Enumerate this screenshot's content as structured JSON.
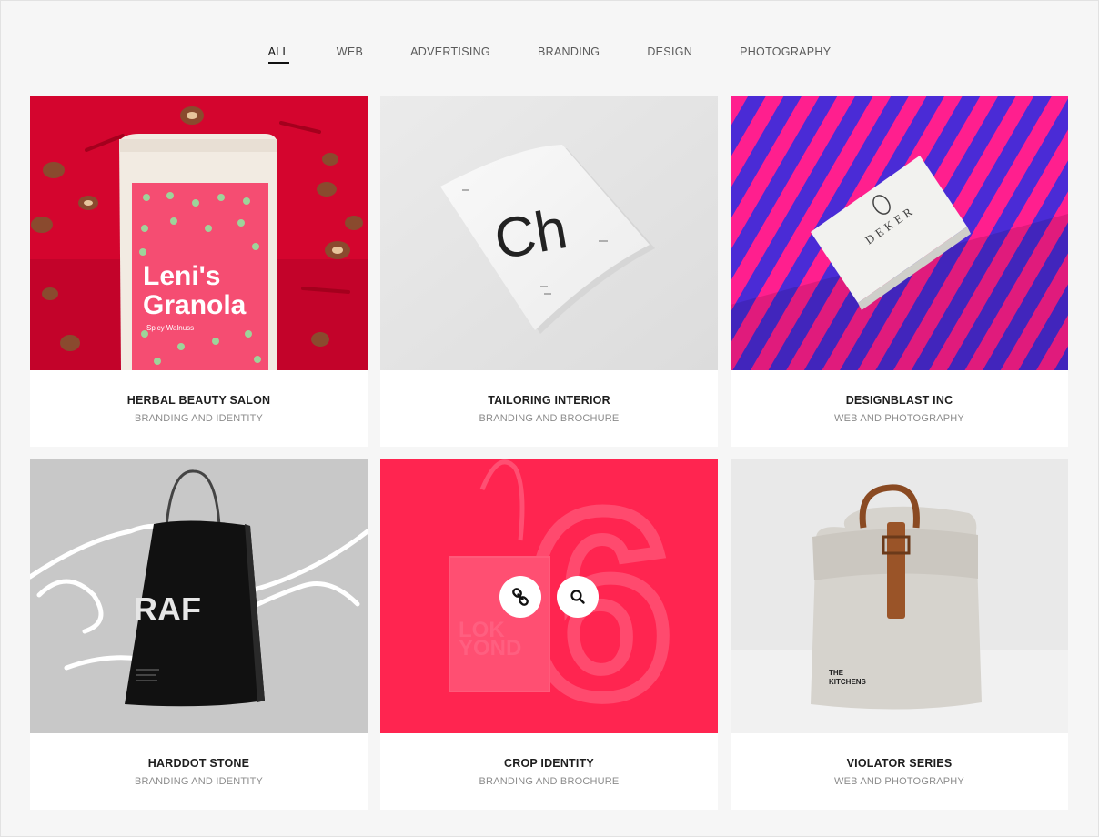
{
  "filters": [
    {
      "label": "ALL",
      "active": true
    },
    {
      "label": "WEB",
      "active": false
    },
    {
      "label": "ADVERTISING",
      "active": false
    },
    {
      "label": "BRANDING",
      "active": false
    },
    {
      "label": "DESIGN",
      "active": false
    },
    {
      "label": "PHOTOGRAPHY",
      "active": false
    }
  ],
  "portfolio": [
    {
      "title": "HERBAL BEAUTY SALON",
      "category": "BRANDING AND IDENTITY",
      "image_text_1": "Leni's",
      "image_text_2": "Granola",
      "image_text_3": "Spicy Walnuss"
    },
    {
      "title": "TAILORING INTERIOR",
      "category": "BRANDING AND BROCHURE",
      "image_text_1": "Ch"
    },
    {
      "title": "DESIGNBLAST INC",
      "category": "WEB AND PHOTOGRAPHY",
      "image_text_1": "DEKER"
    },
    {
      "title": "HARDDOT STONE",
      "category": "BRANDING AND IDENTITY",
      "image_text_1": "RAF"
    },
    {
      "title": "CROP IDENTITY",
      "category": "BRANDING AND BROCHURE",
      "image_text_1": "LOK",
      "image_text_2": "YOND",
      "image_text_3": "6"
    },
    {
      "title": "VIOLATOR SERIES",
      "category": "WEB AND PHOTOGRAPHY",
      "image_text_1": "THE",
      "image_text_2": "KITCHENS"
    }
  ],
  "colors": {
    "accent": "#ff2550",
    "granola_bg": "#d4052e",
    "stripes_pink": "#ff1f8e",
    "stripes_blue": "#4a2bd6"
  },
  "icons": {
    "link": "link-icon",
    "search": "search-icon"
  }
}
